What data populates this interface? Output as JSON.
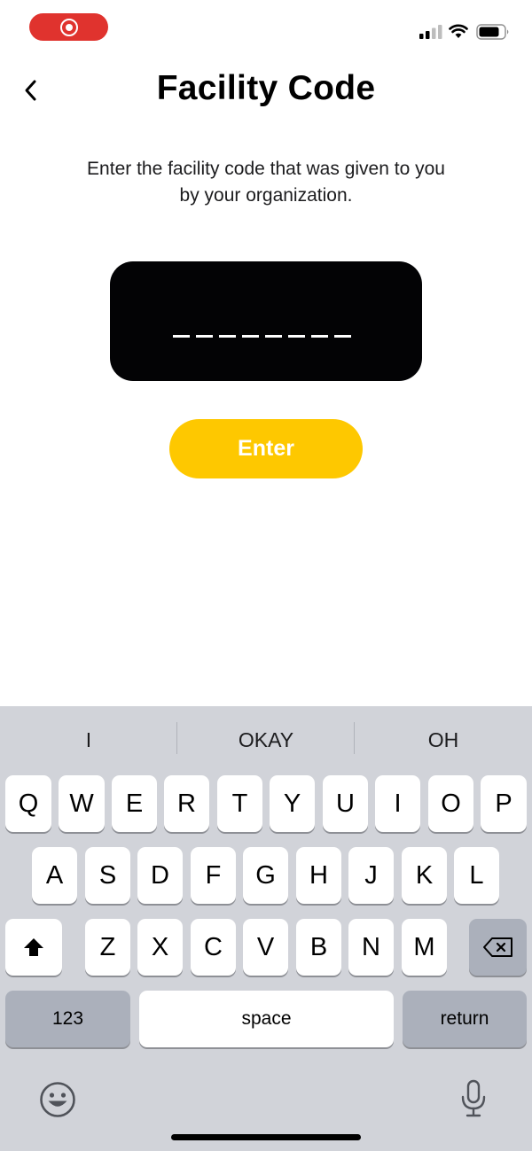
{
  "status_bar": {
    "recording_indicator": "screen-recording-pill",
    "icons": [
      "signal-icon",
      "wifi-icon",
      "battery-icon"
    ],
    "recording_color": "#e0332e"
  },
  "header": {
    "back_icon": "chevron-left-icon",
    "title": "Facility Code"
  },
  "main": {
    "instructions": "Enter the facility code that was given to you by your organization.",
    "code_input": {
      "value": "",
      "length": 8,
      "background": "#030305"
    },
    "enter_button": {
      "label": "Enter",
      "color": "#fec800"
    }
  },
  "keyboard": {
    "suggestions": [
      "I",
      "OKAY",
      "OH"
    ],
    "rows": [
      [
        "Q",
        "W",
        "E",
        "R",
        "T",
        "Y",
        "U",
        "I",
        "O",
        "P"
      ],
      [
        "A",
        "S",
        "D",
        "F",
        "G",
        "H",
        "J",
        "K",
        "L"
      ],
      [
        "Z",
        "X",
        "C",
        "V",
        "B",
        "N",
        "M"
      ]
    ],
    "shift_icon": "shift-arrow-icon",
    "delete_icon": "backspace-icon",
    "numbers_label": "123",
    "space_label": "space",
    "return_label": "return",
    "emoji_icon": "emoji-icon",
    "mic_icon": "microphone-icon"
  }
}
